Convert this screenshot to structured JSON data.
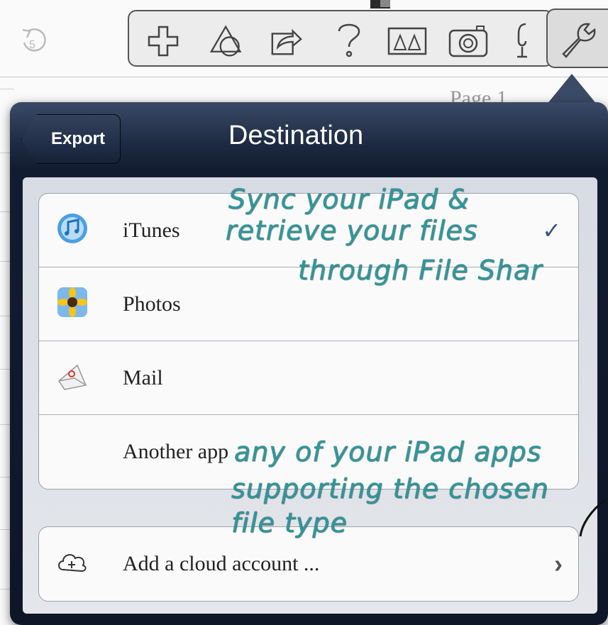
{
  "page": {
    "label": "Page 1"
  },
  "toolbar": {
    "tools": [
      {
        "name": "undo-icon"
      },
      {
        "name": "plus-icon"
      },
      {
        "name": "shapes-icon"
      },
      {
        "name": "share-icon"
      },
      {
        "name": "help-icon"
      },
      {
        "name": "people-icon"
      },
      {
        "name": "camera-icon"
      },
      {
        "name": "microphone-icon"
      },
      {
        "name": "wrench-icon"
      }
    ]
  },
  "popover": {
    "back_label": "Export",
    "title": "Destination",
    "destinations": [
      {
        "label": "iTunes",
        "icon": "itunes-icon",
        "checked": true
      },
      {
        "label": "Photos",
        "icon": "photos-icon",
        "checked": false
      },
      {
        "label": "Mail",
        "icon": "mail-icon",
        "checked": false
      },
      {
        "label": "Another app",
        "icon": "",
        "checked": false
      }
    ],
    "cloud": {
      "label": "Add a cloud account ...",
      "icon": "cloud-plus-icon"
    },
    "check_glyph": "✓",
    "chevron_glyph": "›"
  },
  "annotations": {
    "top_line1": "Sync your iPad &",
    "top_line2": "retrieve your files",
    "top_line3": "through File Shar",
    "bottom_line1": "any of your iPad apps",
    "bottom_line2": "supporting the chosen",
    "bottom_line3": "file type"
  },
  "colors": {
    "annotation": "#2a9a9e",
    "popover_dark": "#0e1628",
    "check": "#37527f"
  }
}
